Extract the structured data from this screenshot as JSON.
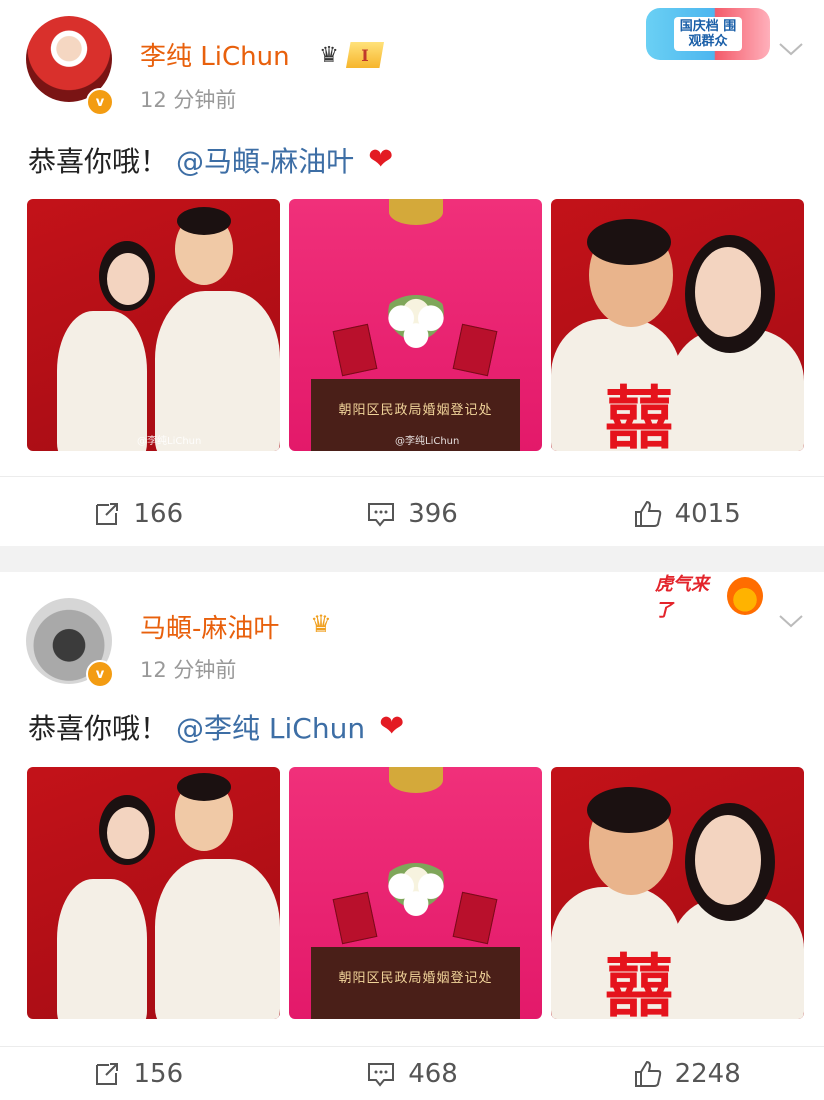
{
  "posts": [
    {
      "username": "李纯 LiChun",
      "level_badge": "I",
      "timestamp": "12 分钟前",
      "text": "恭喜你哦！",
      "mention": "@马頔-麻油叶",
      "emoji": "❤",
      "promo": "国庆档 围观群众",
      "photo_podium_sign": "朝阳区民政局婚姻登记处",
      "photo_caption": "@李纯LiChun",
      "stats": {
        "repost": "166",
        "comment": "396",
        "like": "4015"
      }
    },
    {
      "username": "马頔-麻油叶",
      "timestamp": "12 分钟前",
      "text": "恭喜你哦！",
      "mention": "@李纯 LiChun",
      "emoji": "❤",
      "promo": "虎气来了",
      "photo_podium_sign": "朝阳区民政局婚姻登记处",
      "stats": {
        "repost": "156",
        "comment": "468",
        "like": "2248"
      }
    }
  ],
  "verified_mark": "v",
  "photo_xi": "囍",
  "colors": {
    "username": "#e8600c",
    "mention": "#3d6ea5",
    "heart": "#e31b23",
    "photo_red": "#c31219",
    "photo_pink": "#e3196a"
  },
  "icons": [
    "repost-icon",
    "comment-icon",
    "like-icon",
    "chevron-down-icon",
    "heart-icon",
    "crown-icon"
  ]
}
